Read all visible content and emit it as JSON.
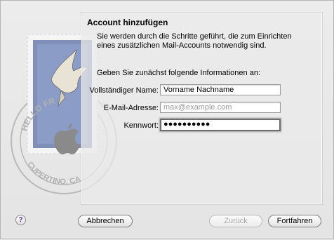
{
  "dialog": {
    "title": "Account hinzufügen",
    "intro": "Sie werden durch die Schritte geführt, die zum Einrichten eines zusätzlichen Mail-Accounts notwendig sind.",
    "prompt": "Geben Sie zunächst folgende Informationen an:"
  },
  "stamp": {
    "text_top": "HELLO FR",
    "text_bottom": "CUPERTINO, CA"
  },
  "form": {
    "full_name": {
      "label": "Vollständiger Name:",
      "value": "Vorname Nachname"
    },
    "email": {
      "label": "E-Mail-Adresse:",
      "placeholder": "max@example.com"
    },
    "password": {
      "label": "Kennwort:",
      "value": "●●●●●●●●●●"
    }
  },
  "buttons": {
    "help": "?",
    "cancel": "Abbrechen",
    "back": "Zurück",
    "continue": "Fortfahren"
  }
}
